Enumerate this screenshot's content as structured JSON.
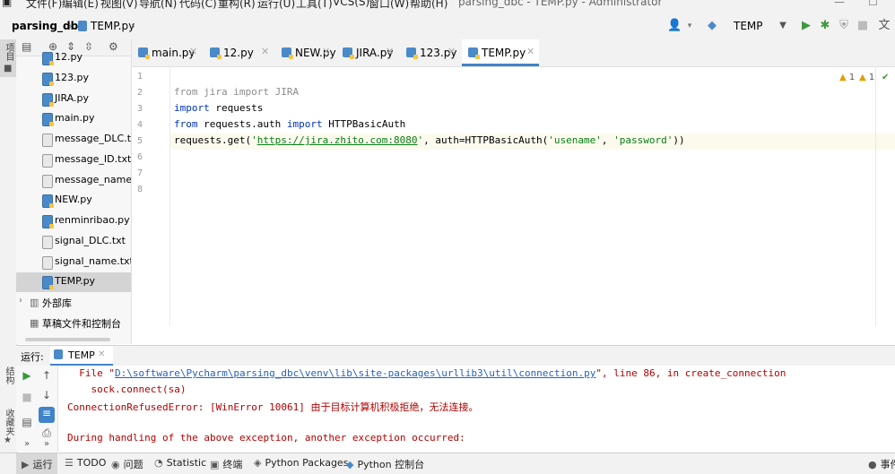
{
  "menubar": {
    "items": [
      "文件(F)",
      "编辑(E)",
      "视图(V)",
      "导航(N)",
      "代码(C)",
      "重构(R)",
      "运行(U)",
      "工具(T)",
      "VCS(S)",
      "窗口(W)",
      "帮助(H)"
    ],
    "window_title": "parsing_dbc - TEMP.py - Administrator"
  },
  "navbar": {
    "project": "parsing_dbc",
    "file": "TEMP.py",
    "run_config": "TEMP"
  },
  "left_stripe": {
    "project_tab": "项目",
    "structure_tab": "结构",
    "favorites_tab": "收藏夹"
  },
  "project_tree": {
    "items": [
      {
        "label": "12.py",
        "type": "py"
      },
      {
        "label": "123.py",
        "type": "py"
      },
      {
        "label": "JIRA.py",
        "type": "py"
      },
      {
        "label": "main.py",
        "type": "py"
      },
      {
        "label": "message_DLC.txt",
        "type": "txt"
      },
      {
        "label": "message_ID.txt",
        "type": "txt"
      },
      {
        "label": "message_name.txt",
        "type": "txt"
      },
      {
        "label": "NEW.py",
        "type": "py"
      },
      {
        "label": "renminribao.py",
        "type": "py"
      },
      {
        "label": "signal_DLC.txt",
        "type": "txt"
      },
      {
        "label": "signal_name.txt",
        "type": "txt"
      },
      {
        "label": "TEMP.py",
        "type": "py",
        "selected": true
      }
    ],
    "external_libs": "外部库",
    "scratches": "草稿文件和控制台"
  },
  "tabs": [
    {
      "label": "main.py"
    },
    {
      "label": "12.py"
    },
    {
      "label": "NEW.py"
    },
    {
      "label": "JIRA.py"
    },
    {
      "label": "123.py"
    },
    {
      "label": "TEMP.py",
      "active": true
    }
  ],
  "editor": {
    "line_numbers": [
      "1",
      "2",
      "3",
      "4",
      "5",
      "6",
      "7",
      "8"
    ],
    "warnings_count": "1",
    "weak_warnings_count": "1",
    "code": {
      "l2_kw1": "from",
      "l2_rest": " jira import JIRA",
      "l3_kw": "import",
      "l3_rest": " requests",
      "l4_kw1": "from",
      "l4_mid": " requests.auth ",
      "l4_kw2": "import",
      "l4_rest": " HTTPBasicAuth",
      "l5_a": "requests.get(",
      "l5_q1": "'",
      "l5_url": "https://jira.zhito.com:8080",
      "l5_q2": "'",
      "l5_b": ", auth=HTTPBasicAuth(",
      "l5_s1": "'usename'",
      "l5_c": ", ",
      "l5_s2": "'password'",
      "l5_d": "))"
    }
  },
  "run_panel": {
    "label": "运行:",
    "tab": "TEMP",
    "console": {
      "l1_a": "  File \"",
      "l1_link": "D:\\software\\Pycharm\\parsing_dbc\\venv\\lib\\site-packages\\urllib3\\util\\connection.py",
      "l1_b": "\", line 86, in create_connection",
      "l2": "    sock.connect(sa)",
      "l3": "ConnectionRefusedError: [WinError 10061] 由于目标计算机积极拒绝，无法连接。",
      "l4": "",
      "l5": "During handling of the above exception, another exception occurred:"
    }
  },
  "bottom_bar": {
    "run": "运行",
    "todo": "TODO",
    "problems": "问题",
    "statistic": "Statistic",
    "terminal": "终端",
    "python_packages": "Python Packages",
    "python_console": "Python 控制台",
    "event_log": "事件"
  },
  "colors": {
    "keyword": "#0033b3",
    "string": "#067d17",
    "error": "#b30000",
    "accent": "#4083c9"
  }
}
